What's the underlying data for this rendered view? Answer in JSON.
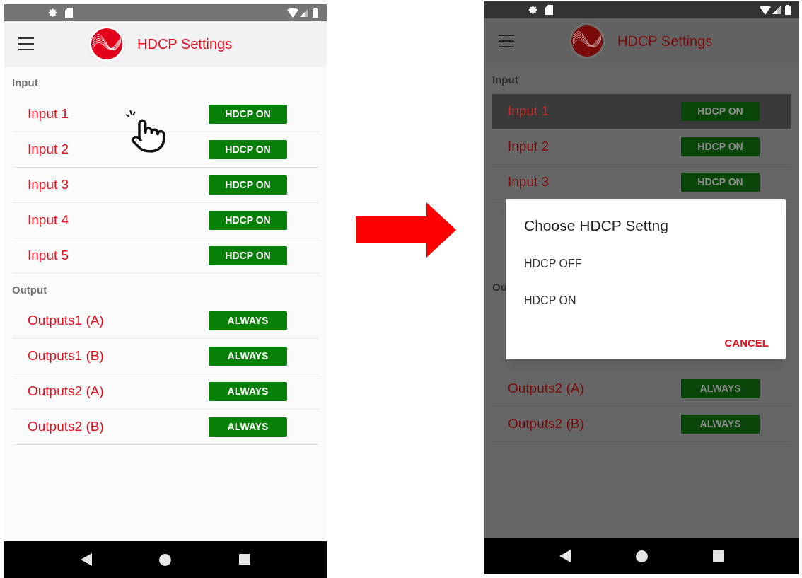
{
  "screens": [
    {
      "dimmed": false,
      "title": "HDCP Settings",
      "tap_hint": true,
      "sections": [
        {
          "header": "Input",
          "rows": [
            {
              "kind": "row",
              "label": "Input 1",
              "value": "HDCP ON",
              "selected": false
            },
            {
              "kind": "row",
              "label": "Input 2",
              "value": "HDCP ON",
              "selected": false
            },
            {
              "kind": "row",
              "label": "Input 3",
              "value": "HDCP ON",
              "selected": false
            },
            {
              "kind": "row",
              "label": "Input 4",
              "value": "HDCP ON",
              "selected": false
            },
            {
              "kind": "row",
              "label": "Input 5",
              "value": "HDCP ON",
              "selected": false
            }
          ]
        },
        {
          "header": "Output",
          "rows": [
            {
              "kind": "row",
              "label": "Outputs1 (A)",
              "value": "ALWAYS",
              "selected": false
            },
            {
              "kind": "row",
              "label": "Outputs1 (B)",
              "value": "ALWAYS",
              "selected": false
            },
            {
              "kind": "row",
              "label": "Outputs2 (A)",
              "value": "ALWAYS",
              "selected": false
            },
            {
              "kind": "row",
              "label": "Outputs2 (B)",
              "value": "ALWAYS",
              "selected": false
            }
          ]
        }
      ]
    },
    {
      "dimmed": true,
      "title": "HDCP Settings",
      "tap_hint": false,
      "sections": [
        {
          "header": "Input",
          "rows": [
            {
              "kind": "row",
              "label": "Input 1",
              "value": "HDCP ON",
              "selected": true
            },
            {
              "kind": "row",
              "label": "Input 2",
              "value": "HDCP ON",
              "selected": false
            },
            {
              "kind": "row",
              "label": "Input 3",
              "value": "HDCP ON",
              "selected": false
            },
            {
              "kind": "covered"
            },
            {
              "kind": "covered"
            }
          ]
        },
        {
          "header": "Ou",
          "rows": [
            {
              "kind": "covered"
            },
            {
              "kind": "covered"
            },
            {
              "kind": "row",
              "label": "Outputs2 (A)",
              "value": "ALWAYS",
              "selected": false
            },
            {
              "kind": "row",
              "label": "Outputs2 (B)",
              "value": "ALWAYS",
              "selected": false
            }
          ]
        }
      ],
      "dialog": {
        "title": "Choose HDCP Settng",
        "options": [
          "HDCP OFF",
          "HDCP ON"
        ],
        "action": "CANCEL"
      }
    }
  ]
}
